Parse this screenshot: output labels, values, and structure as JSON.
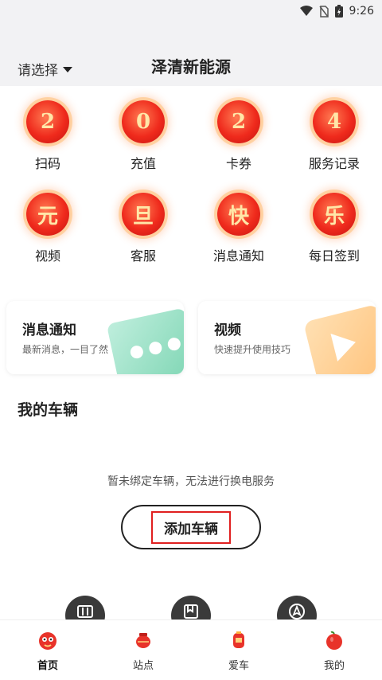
{
  "status": {
    "time": "9:26"
  },
  "header": {
    "region_label": "请选择",
    "title": "泽清新能源"
  },
  "grid": [
    {
      "glyph": "2",
      "label": "扫码"
    },
    {
      "glyph": "0",
      "label": "充值"
    },
    {
      "glyph": "2",
      "label": "卡券"
    },
    {
      "glyph": "4",
      "label": "服务记录"
    },
    {
      "glyph": "元",
      "label": "视频"
    },
    {
      "glyph": "旦",
      "label": "客服"
    },
    {
      "glyph": "快",
      "label": "消息通知"
    },
    {
      "glyph": "乐",
      "label": "每日签到"
    }
  ],
  "cards": {
    "message": {
      "title": "消息通知",
      "subtitle": "最新消息，一目了然"
    },
    "video": {
      "title": "视频",
      "subtitle": "快速提升使用技巧"
    }
  },
  "vehicles": {
    "section_title": "我的车辆",
    "empty_text": "暂未绑定车辆，无法进行换电服务",
    "add_button": "添加车辆"
  },
  "nav": [
    {
      "label": "首页",
      "icon": "home-icon",
      "active": true
    },
    {
      "label": "站点",
      "icon": "station-icon"
    },
    {
      "label": "爱车",
      "icon": "car-icon"
    },
    {
      "label": "我的",
      "icon": "profile-icon"
    }
  ],
  "colors": {
    "coin": "#ef2a1c",
    "coin_text": "#ffe7a8",
    "highlight_border": "#e02020",
    "float_button": "#3a3a3a"
  }
}
